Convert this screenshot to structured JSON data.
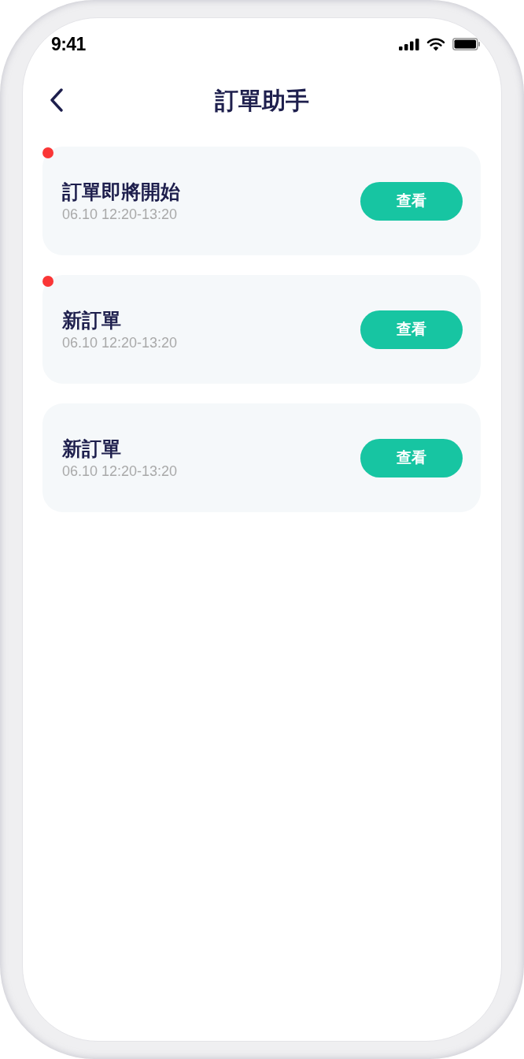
{
  "status_bar": {
    "time": "9:41"
  },
  "nav_bar": {
    "title": "訂單助手"
  },
  "notifications": [
    {
      "unread": true,
      "title": "訂單即將開始",
      "time": "06.10 12:20-13:20",
      "button": "查看"
    },
    {
      "unread": true,
      "title": "新訂單",
      "time": "06.10 12:20-13:20",
      "button": "查看"
    },
    {
      "unread": false,
      "title": "新訂單",
      "time": "06.10 12:20-13:20",
      "button": "查看"
    }
  ]
}
